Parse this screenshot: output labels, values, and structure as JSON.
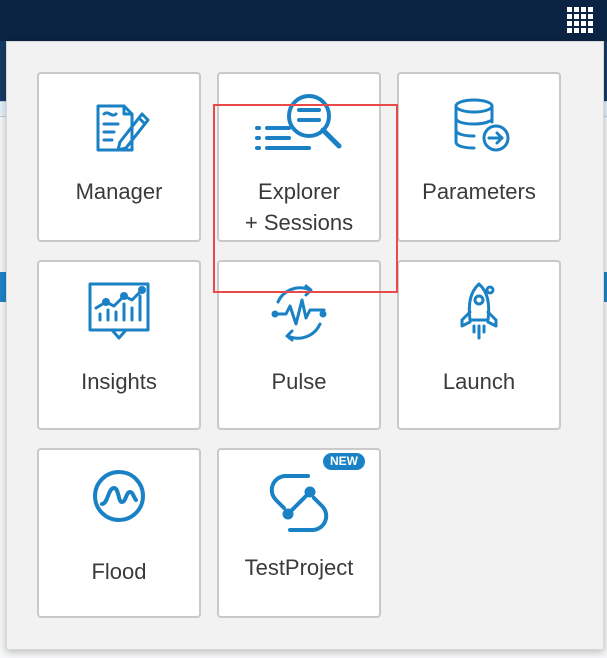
{
  "apps": [
    {
      "label": "Manager",
      "icon": "document-edit-icon"
    },
    {
      "label_line1": "Explorer",
      "label_line2": "+ Sessions",
      "icon": "search-list-icon",
      "highlighted": true
    },
    {
      "label": "Parameters",
      "icon": "database-arrow-icon"
    },
    {
      "label": "Insights",
      "icon": "chart-board-icon"
    },
    {
      "label": "Pulse",
      "icon": "pulse-cycle-icon"
    },
    {
      "label": "Launch",
      "icon": "rocket-icon"
    },
    {
      "label": "Flood",
      "icon": "wave-circle-icon"
    },
    {
      "label": "TestProject",
      "icon": "testproject-logo-icon",
      "badge": "NEW"
    }
  ],
  "colors": {
    "icon": "#1a82c4",
    "topbar": "#0b2443",
    "highlight_border": "#e84a4a",
    "badge": "#1a82c4"
  }
}
